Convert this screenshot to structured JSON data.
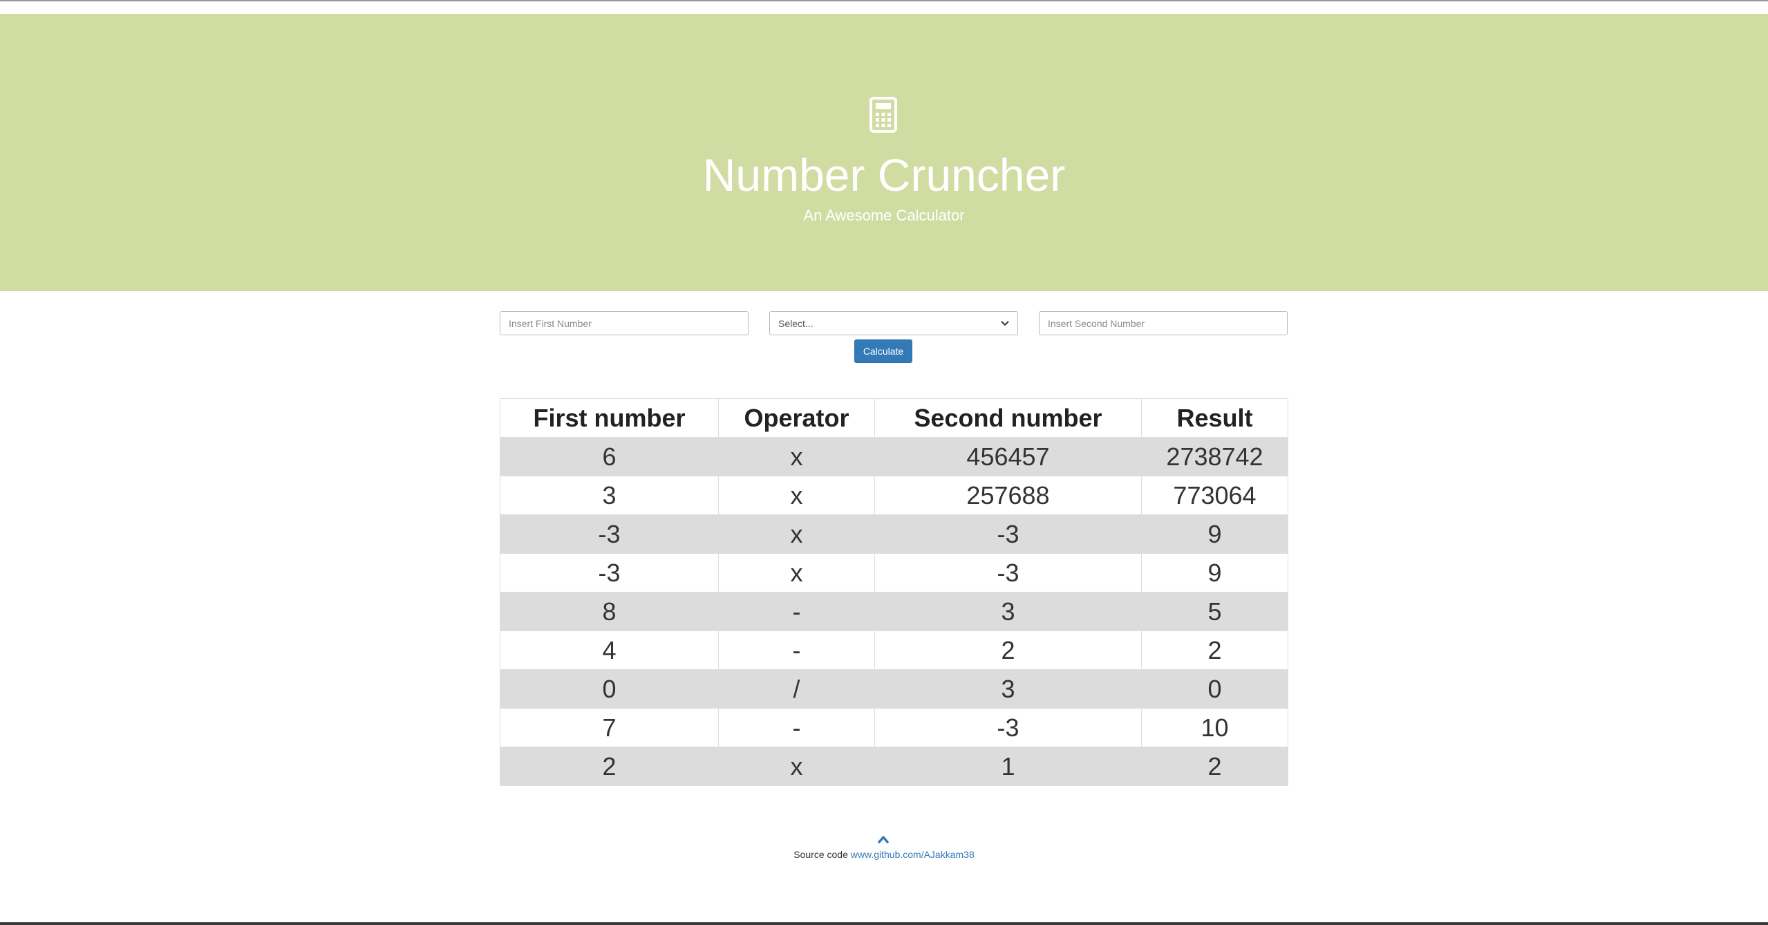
{
  "header": {
    "icon": "calculator-icon",
    "title": "Number Cruncher",
    "subtitle": "An Awesome Calculator",
    "background_color": "#d0dca2"
  },
  "form": {
    "first_number": {
      "value": "",
      "placeholder": "Insert First Number"
    },
    "operator": {
      "selected": "Select..."
    },
    "second_number": {
      "value": "",
      "placeholder": "Insert Second Number"
    },
    "calculate_label": "Calculate",
    "button_color": "#337ab7"
  },
  "table": {
    "columns": [
      "First number",
      "Operator",
      "Second number",
      "Result"
    ],
    "rows": [
      [
        "6",
        "x",
        "456457",
        "2738742"
      ],
      [
        "3",
        "x",
        "257688",
        "773064"
      ],
      [
        "-3",
        "x",
        "-3",
        "9"
      ],
      [
        "-3",
        "x",
        "-3",
        "9"
      ],
      [
        "8",
        "-",
        "3",
        "5"
      ],
      [
        "4",
        "-",
        "2",
        "2"
      ],
      [
        "0",
        "/",
        "3",
        "0"
      ],
      [
        "7",
        "-",
        "-3",
        "10"
      ],
      [
        "2",
        "x",
        "1",
        "2"
      ]
    ]
  },
  "footer": {
    "up_icon": "chevron-up-icon",
    "source_label": "Source code",
    "link_text": "www.github.com/AJakkam38"
  }
}
